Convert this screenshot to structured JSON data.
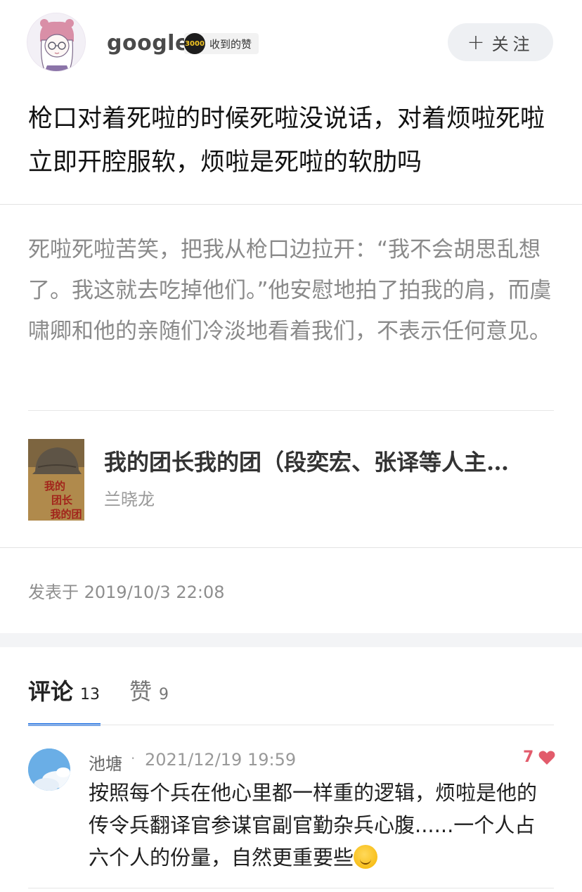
{
  "header": {
    "username": "google",
    "likes_badge_value": "3000",
    "likes_badge_label": "收到的赞",
    "follow_plus": "+",
    "follow_label": "关注"
  },
  "post": {
    "title": "枪口对着死啦的时候死啦没说话，对着烦啦死啦立即开腔服软，烦啦是死啦的软肋吗",
    "excerpt": "死啦死啦苦笑，把我从枪口边拉开：“我不会胡思乱想了。我这就去吃掉他们。”他安慰地拍了拍我的肩，而虞啸卿和他的亲随们冷淡地看着我们，不表示任何意见。",
    "book": {
      "title": "我的团长我的团（段奕宏、张译等人主…",
      "author": "兰晓龙",
      "cover_text": "我的团长我的团"
    },
    "published": "发表于 2019/10/3 22:08"
  },
  "tabs": {
    "comments_label": "评论",
    "comments_count": "13",
    "likes_label": "赞",
    "likes_count": "9"
  },
  "comments": [
    {
      "author": "池塘",
      "separator": "·",
      "time": "2021/12/19 19:59",
      "likes": "7",
      "text": "按照每个兵在他心里都一样重的逻辑，烦啦是他的传令兵翻译官参谋官副官勤杂兵心腹......一个人占六个人的份量，自然更重要些"
    }
  ],
  "colors": {
    "accent_blue": "#3b82e6",
    "like_red": "#e25b6b",
    "band_gray": "#f3f4f6"
  }
}
